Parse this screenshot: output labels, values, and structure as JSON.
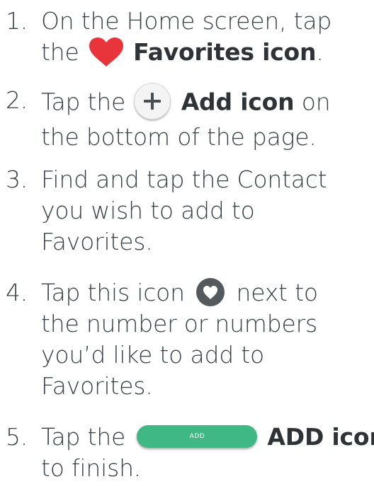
{
  "steps": [
    {
      "num": "1.",
      "line1_a": "On the Home screen, tap",
      "line2_a": "the",
      "icon": "heart-icon",
      "bold": "Favorites icon",
      "line2_b": "."
    },
    {
      "num": "2.",
      "line1_a": "Tap the",
      "icon": "plus-circle-icon",
      "bold": "Add icon",
      "line1_b": "on",
      "line2": "the bottom of the page."
    },
    {
      "num": "3.",
      "line1": "Find and tap the Contact",
      "line2": "you wish to add to",
      "line3": "Favorites."
    },
    {
      "num": "4.",
      "line1_a": "Tap this icon",
      "icon": "heart-circle-icon",
      "line1_b": "next to",
      "line2": "the number or numbers",
      "line3": "you’d like to add to",
      "line4": "Favorites."
    },
    {
      "num": "5.",
      "line1_a": "Tap the",
      "icon": "add-button-icon",
      "button_text": "ADD",
      "bold": "ADD icon",
      "line2": "to finish."
    }
  ],
  "colors": {
    "text": "#3a3f44",
    "heart": "#e8353c",
    "add_button": "#3fb885",
    "circle_icon": "#54595e"
  }
}
